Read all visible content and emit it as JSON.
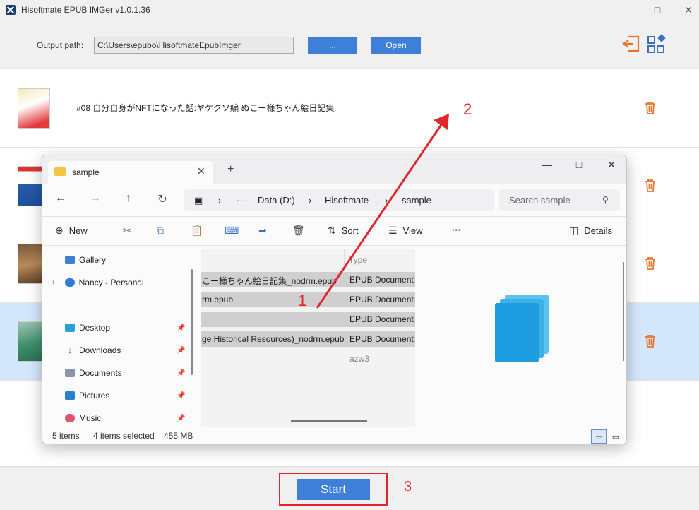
{
  "app": {
    "title": "Hisoftmate EPUB IMGer v1.0.1.36",
    "output_label": "Output path:",
    "output_path": "C:\\Users\\epubo\\HisoftmateEpubImger",
    "browse_label": "...",
    "open_label": "Open",
    "start_label": "Start"
  },
  "books": [
    {
      "title": "#08 自分自身がNFTになった話:ヤケクソ編 ぬこー様ちゃん絵日記集"
    },
    {
      "title": ""
    },
    {
      "title": ""
    },
    {
      "title": ""
    }
  ],
  "annotations": {
    "step1": "1",
    "step2": "2",
    "step3": "3"
  },
  "explorer": {
    "tab_title": "sample",
    "path": {
      "drive": "Data (D:)",
      "folder1": "Hisoftmate",
      "folder2": "sample",
      "more": "···"
    },
    "search_placeholder": "Search sample",
    "commands": {
      "new": "New",
      "sort": "Sort",
      "view": "View",
      "more": "···",
      "details": "Details"
    },
    "nav_items": [
      {
        "label": "Gallery"
      },
      {
        "label": "Nancy - Personal"
      },
      {
        "label": "Desktop"
      },
      {
        "label": "Downloads"
      },
      {
        "label": "Documents"
      },
      {
        "label": "Pictures"
      },
      {
        "label": "Music"
      }
    ],
    "column_type": "Type",
    "files": [
      {
        "name": "こー様ちゃん絵日記集_nodrm.epub",
        "type": "EPUB Document"
      },
      {
        "name": "rm.epub",
        "type": "EPUB Document"
      },
      {
        "name": "",
        "type": "EPUB Document"
      },
      {
        "name": "ge Historical Resources)_nodrm.epub",
        "type": "EPUB Document"
      },
      {
        "name": "",
        "type": "azw3"
      }
    ],
    "status": {
      "count": "5 items",
      "selected": "4 items selected",
      "size": "455 MB"
    }
  },
  "colors": {
    "accent": "#3d7fd9",
    "annotation_red": "#e0262b",
    "icon_orange": "#e8742a",
    "selected_row": "#d5e7fb"
  }
}
